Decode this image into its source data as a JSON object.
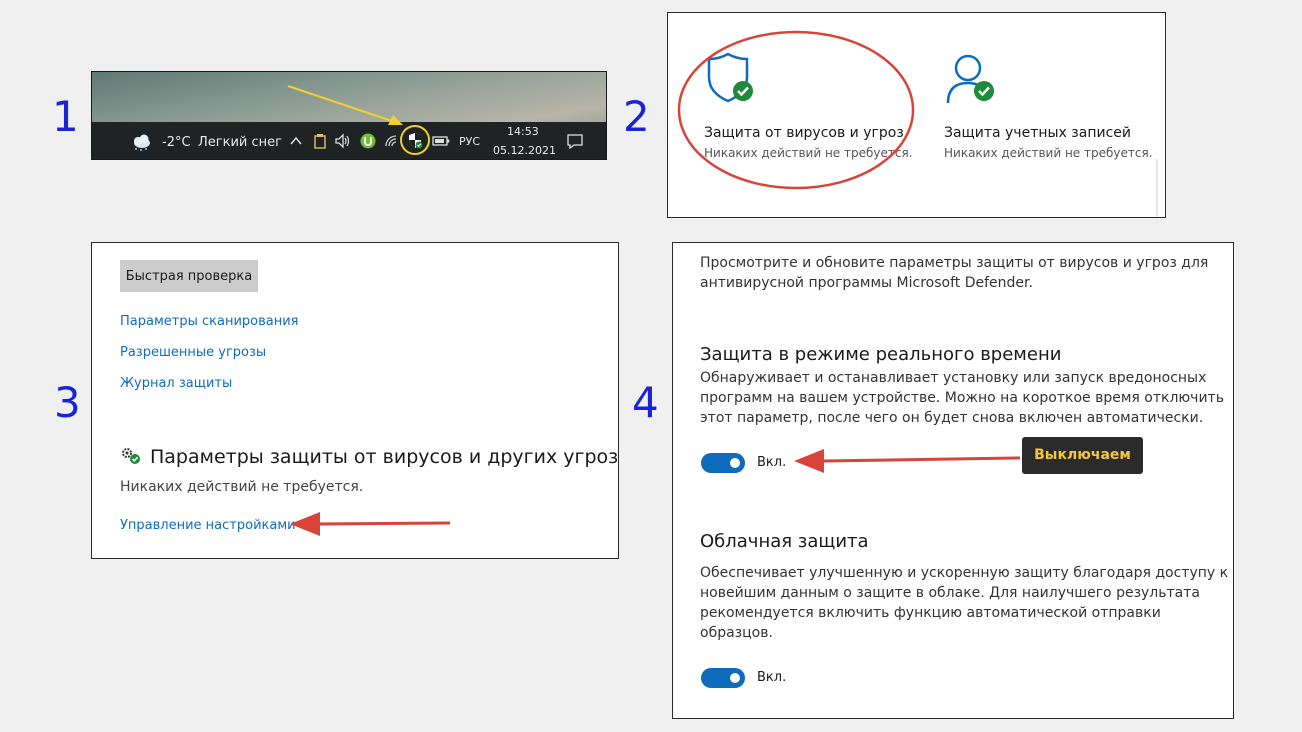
{
  "steps": [
    "1",
    "2",
    "3",
    "4"
  ],
  "taskbar": {
    "weather_temp": "-2°C",
    "weather_desc": "Легкий снег",
    "language": "РУС",
    "time": "14:53",
    "date": "05.12.2021",
    "icons": [
      "cloud-snow-icon",
      "chevron-up-icon",
      "clipboard-icon",
      "volume-icon",
      "utorrent-icon",
      "wifi-icon",
      "defender-shield-icon",
      "battery-icon",
      "notification-icon"
    ],
    "highlight_color": "#f2d12b"
  },
  "security_tiles": {
    "virus": {
      "title": "Защита от вирусов и угроз",
      "subtitle": "Никаких действий не требуется."
    },
    "account": {
      "title": "Защита учетных записей",
      "subtitle": "Никаких действий не требуется."
    },
    "annotation_color": "#d9443a"
  },
  "virus_page": {
    "quick_scan": "Быстрая проверка",
    "links": [
      "Параметры сканирования",
      "Разрешенные угрозы",
      "Журнал защиты"
    ],
    "settings_title": "Параметры защиты от вирусов и других угроз",
    "settings_status": "Никаких действий не требуется.",
    "manage_link": "Управление настройками"
  },
  "settings_page": {
    "intro": [
      "Просмотрите и обновите параметры защиты от вирусов и угроз для",
      "антивирусной программы Microsoft Defender."
    ],
    "realtime": {
      "title": "Защита в режиме реального времени",
      "desc": [
        "Обнаруживает и останавливает установку или запуск вредоносных",
        "программ на вашем устройстве. Можно на короткое время отключить",
        "этот параметр, после чего он будет снова включен автоматически."
      ],
      "toggle_label": "Вкл.",
      "toggle_on": true
    },
    "callout": "Выключаем",
    "cloud": {
      "title": "Облачная защита",
      "desc": [
        "Обеспечивает улучшенную и ускоренную защиту благодаря доступу к",
        "новейшим данным о защите в облаке. Для наилучшего результата",
        "рекомендуется включить функцию автоматической отправки",
        "образцов."
      ],
      "toggle_label": "Вкл.",
      "toggle_on": true
    }
  },
  "colors": {
    "accent": "#0f6cbd",
    "step_number": "#1a23d6",
    "arrow": "#d9443a",
    "check": "#1f8a3b"
  }
}
